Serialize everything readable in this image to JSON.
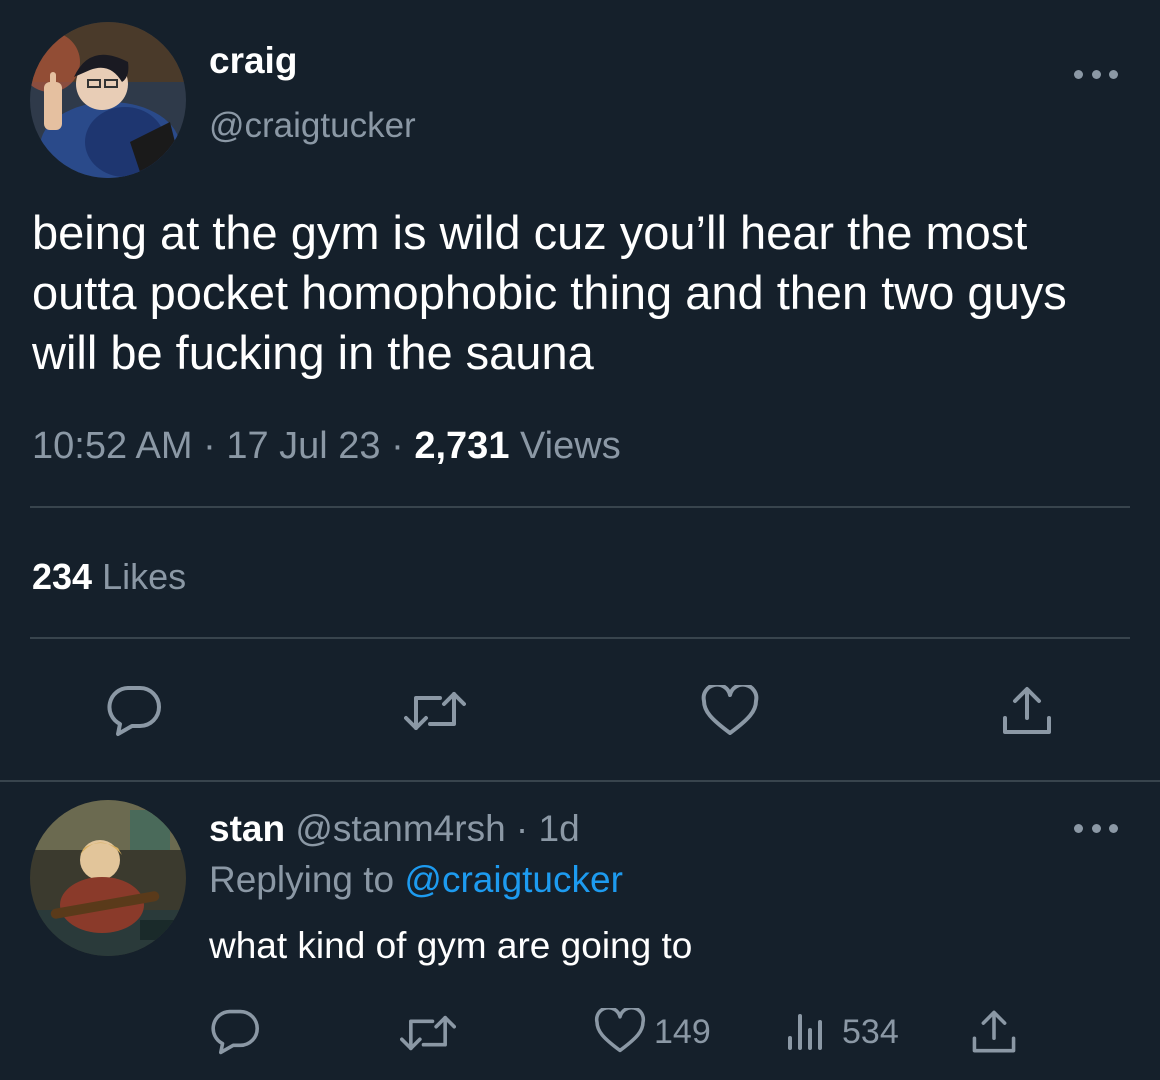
{
  "main_tweet": {
    "display_name": "craig",
    "handle": "@craigtucker",
    "text": "being at the gym is wild cuz you’ll hear the most outta pocket homophobic thing and then two guys will be fucking in the sauna",
    "time": "10:52 AM",
    "separator1": " · ",
    "date": "17 Jul 23",
    "separator2": " · ",
    "views_count": "2,731",
    "views_label": " Views",
    "likes_count": "234",
    "likes_label": " Likes",
    "actions": {
      "reply_icon": "reply-icon",
      "retweet_icon": "retweet-icon",
      "like_icon": "heart-icon",
      "share_icon": "share-icon"
    }
  },
  "reply_tweet": {
    "display_name": "stan",
    "handle": " @stanm4rsh",
    "separator": " · ",
    "age": "1d",
    "replying_prefix": "Replying to ",
    "replying_handle": "@craigtucker",
    "text": "what kind of gym are going to",
    "likes_count": "149",
    "views_count": "534"
  },
  "colors": {
    "background": "#15202b",
    "text_primary": "#ffffff",
    "text_secondary": "#8b98a5",
    "link": "#1d9bf0",
    "divider": "#38444d"
  }
}
